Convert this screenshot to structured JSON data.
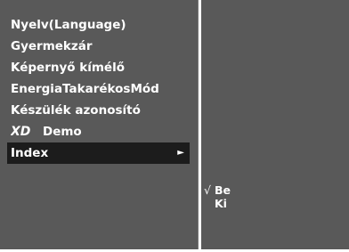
{
  "menu": {
    "items": [
      {
        "label": "Nyelv(Language)"
      },
      {
        "label": "Gyermekzár"
      },
      {
        "label": "Képernyő kímélő"
      },
      {
        "label": "EnergiaTakarékosMód"
      },
      {
        "label": "Készülék azonosító"
      },
      {
        "label": "Demo",
        "logo": "XD"
      },
      {
        "label": "Index",
        "selected": true,
        "icon": "right-arrow-icon",
        "arrow": "►"
      }
    ]
  },
  "submenu": {
    "check": "√",
    "options": [
      {
        "label": "Be",
        "checked": true
      },
      {
        "label": "Ki",
        "checked": false
      }
    ]
  }
}
